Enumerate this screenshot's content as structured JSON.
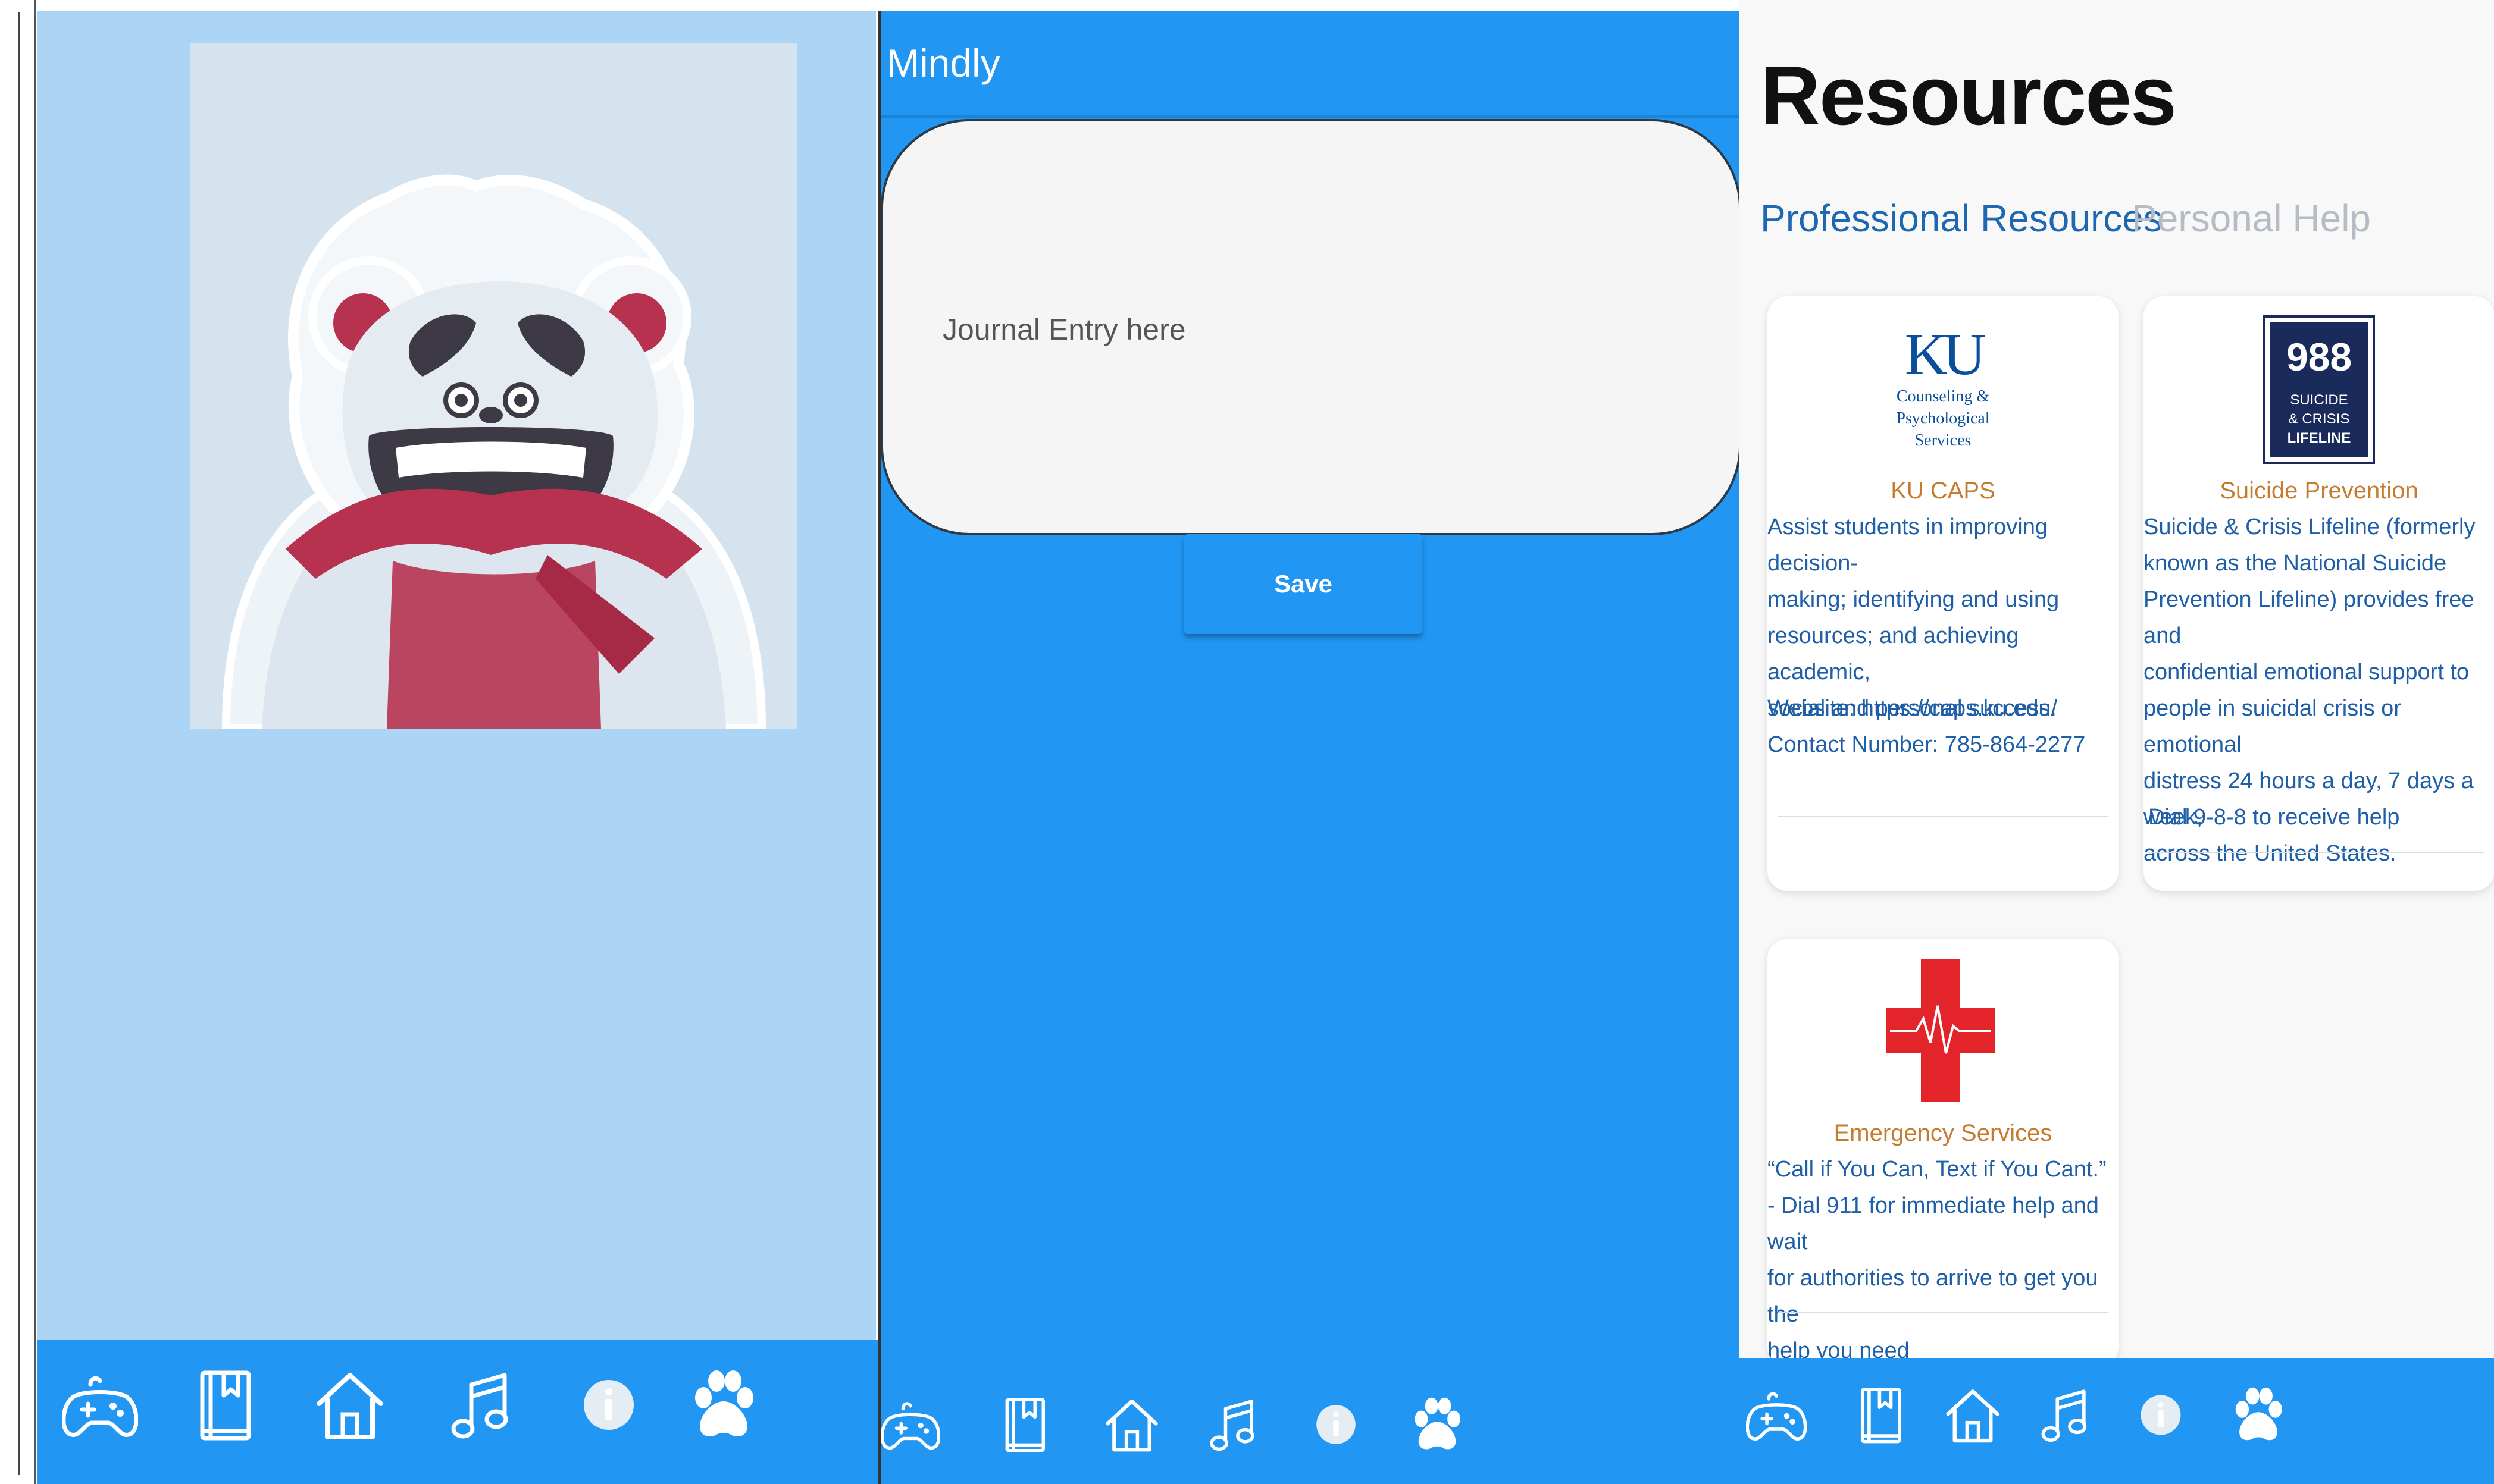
{
  "journal": {
    "app_title": "Mindly",
    "entry_placeholder": "Journal Entry here",
    "save_label": "Save"
  },
  "resources": {
    "title": "Resources",
    "tabs": {
      "professional": "Professional Resources",
      "personal": "Personal Help"
    },
    "ku_caps": {
      "logo_mark": "KU",
      "logo_lines": [
        "Counseling &",
        "Psychological",
        "Services"
      ],
      "title": "KU CAPS",
      "description": "Assist students in improving decision-\nmaking; identifying and using\nresources; and achieving academic,\nsocial and personal success.",
      "website": "Website: https://caps.ku.edu/",
      "contact": "Contact Number: 785-864-2277"
    },
    "suicide_prevention": {
      "logo_number": "988",
      "logo_lines": [
        "SUICIDE",
        "& CRISIS",
        "LIFELINE"
      ],
      "title": "Suicide Prevention",
      "description": "Suicide & Crisis Lifeline (formerly\nknown as the National Suicide\nPrevention Lifeline) provides free and\nconfidential emotional support to\npeople in suicidal crisis or emotional\ndistress 24 hours a day, 7 days a week,\nacross the United States.",
      "action": "Dial 9-8-8 to receive help"
    },
    "emergency": {
      "title": "Emergency Services",
      "description": "“Call if You Can, Text if You Cant.”\n- Dial 911 for immediate help and wait\nfor authorities to arrive to get you the\nhelp you need"
    }
  },
  "nav_items": [
    "gamepad-icon",
    "journal-book-icon",
    "home-icon",
    "music-note-icon",
    "info-icon",
    "paw-icon"
  ],
  "colors": {
    "primary_blue": "#2196f3",
    "pet_background": "#acd4f5",
    "link_blue": "#1f5fa8",
    "card_title_orange": "#c67c2e",
    "ku_blue": "#0b4e9b",
    "lifeline_navy": "#1a2a5a",
    "red_cross": "#e3252b"
  }
}
